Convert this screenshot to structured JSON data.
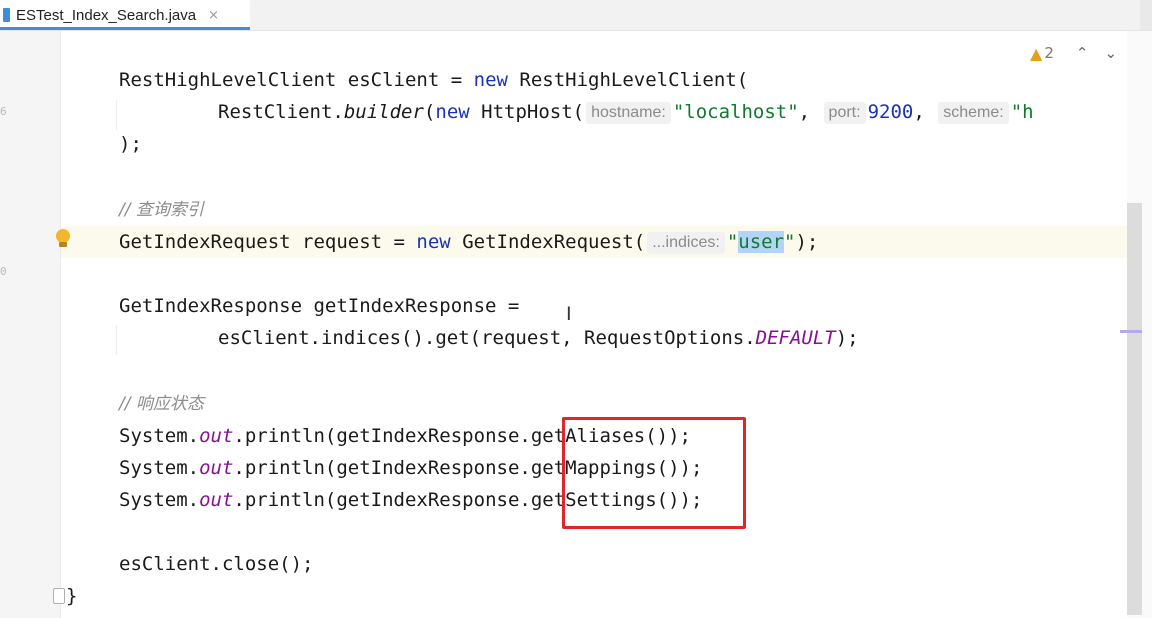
{
  "tab": {
    "title": "ESTest_Index_Search.java",
    "close": "×"
  },
  "inspection": {
    "count": "2",
    "up": "⌃",
    "down": "⌄"
  },
  "gutter_digits": [
    "6",
    "",
    "",
    "",
    "",
    "",
    "",
    "",
    "0",
    "",
    "",
    "",
    "",
    "",
    "",
    "",
    "",
    "",
    ""
  ],
  "code": {
    "l1": {
      "type": "RestHighLevelClient",
      "var": "esClient",
      "eq": " = ",
      "kw_new": "new",
      "ctor": " RestHighLevelClient("
    },
    "l2": {
      "a": "RestClient.",
      "builder": "builder",
      "b": "(",
      "kw_new": "new",
      "c": " HttpHost(",
      "hint_hostname": "hostname:",
      "host_val": "\"localhost\"",
      "comma1": ", ",
      "hint_port": "port:",
      "port_val": "9200",
      "comma2": ", ",
      "hint_scheme": "scheme:",
      "scheme_val": "\"h"
    },
    "l3": ");",
    "c1": "// 查询索引",
    "l4": {
      "a": "GetIndexRequest request = ",
      "kw_new": "new",
      "b": " GetIndexRequest(",
      "hint_indices": "...indices:",
      "q1": "\"",
      "sel": "user",
      "q2": "\"",
      "end": ");"
    },
    "l5": "GetIndexResponse getIndexResponse =",
    "l6": {
      "a": "esClient.indices().get(request, RequestOptions.",
      "field": "DEFAULT",
      "end": ");"
    },
    "c2": "// 响应状态",
    "l7": {
      "a": "System.",
      "out": "out",
      "b": ".println(getIndexResponse.getAliases());"
    },
    "l8": {
      "a": "System.",
      "out": "out",
      "b": ".println(getIndexResponse.getMappings());"
    },
    "l9": {
      "a": "System.",
      "out": "out",
      "b": ".println(getIndexResponse.getSettings());"
    },
    "l10": "esClient.close();",
    "l11": "}"
  },
  "colors": {
    "keyword": "#1a33b3",
    "string": "#117a2d",
    "static": "#871094",
    "comment": "#8c8c8c",
    "highlight": "#e0262b"
  }
}
